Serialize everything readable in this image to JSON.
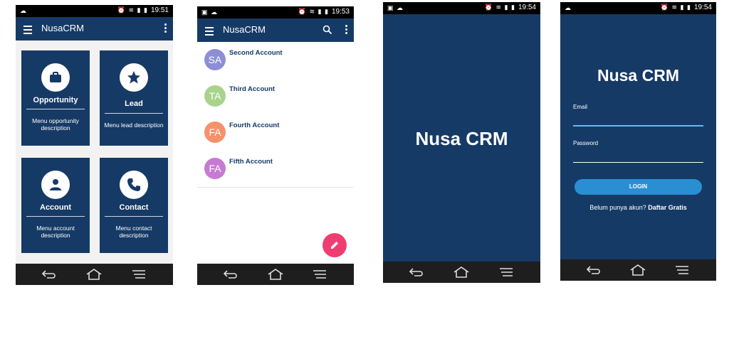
{
  "colors": {
    "primary": "#163a66",
    "accent": "#ee3e71",
    "button": "#2a8fd2"
  },
  "screen1": {
    "time": "19:51",
    "app_title": "NusaCRM",
    "tiles": [
      {
        "title": "Opportunity",
        "description": "Menu opportunity description",
        "icon": "briefcase-icon"
      },
      {
        "title": "Lead",
        "description": "Menu lead description",
        "icon": "star-icon"
      },
      {
        "title": "Account",
        "description": "Menu account description",
        "icon": "person-icon"
      },
      {
        "title": "Contact",
        "description": "Menu contact description",
        "icon": "phone-icon"
      }
    ]
  },
  "screen2": {
    "time": "19:53",
    "app_title": "NusaCRM",
    "accounts": [
      {
        "initials": "SA",
        "name": "Second Account",
        "color": "#8c8fd6"
      },
      {
        "initials": "TA",
        "name": "Third Account",
        "color": "#a8d38b"
      },
      {
        "initials": "FA",
        "name": "Fourth Account",
        "color": "#f5916b"
      },
      {
        "initials": "FA",
        "name": "Fifth Account",
        "color": "#c77ad3"
      }
    ]
  },
  "screen3": {
    "time": "19:54",
    "title": "Nusa CRM"
  },
  "screen4": {
    "time": "19:54",
    "title": "Nusa CRM",
    "email_label": "Email",
    "password_label": "Password",
    "login_label": "LOGIN",
    "register_prompt": "Belum punya akun?",
    "register_link": "Daftar Gratis"
  }
}
